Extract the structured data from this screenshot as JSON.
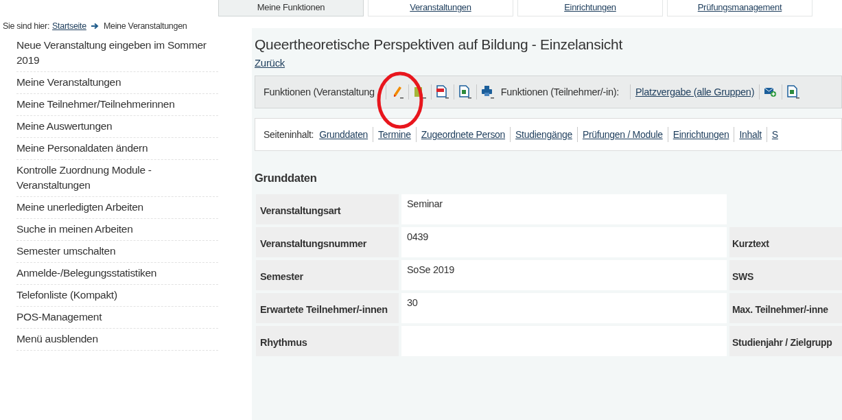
{
  "top_tabs": [
    {
      "label": "Meine Funktionen",
      "selected": true
    },
    {
      "label": "Veranstaltungen",
      "selected": false
    },
    {
      "label": "Einrichtungen",
      "selected": false
    },
    {
      "label": "Prüfungsmanagement",
      "selected": false
    }
  ],
  "breadcrumb": {
    "prefix": "Sie sind hier:",
    "link": "Startseite",
    "current": "Meine Veranstaltungen"
  },
  "sidebar": {
    "items": [
      "Neue Veranstaltung eingeben im Sommer 2019",
      "Meine Veranstaltungen",
      "Meine Teilnehmer/Teilnehmerinnen",
      "Meine Auswertungen",
      "Meine Personaldaten ändern",
      "Kontrolle Zuordnung Module - Veranstaltungen",
      "Meine unerledigten Arbeiten",
      "Suche in meinen Arbeiten",
      "Semester umschalten",
      "Anmelde-/Belegungsstatistiken",
      "Telefonliste (Kompakt)",
      "POS-Management",
      "Menü ausblenden"
    ]
  },
  "page": {
    "title": "Queertheoretische Perspektiven auf Bildung - Einzelansicht",
    "back_link": "Zurück",
    "toolbar": {
      "label_course": "Funktionen (Veranstaltung",
      "course_icons": [
        {
          "kind": "pencil"
        },
        {
          "kind": "clipboard"
        },
        {
          "kind": "pdf"
        },
        {
          "kind": "excel"
        },
        {
          "kind": "printer"
        }
      ],
      "label_participants": "Funktionen (Teilnehmer/-in):",
      "participants_link": "Platzvergabe (alle Gruppen)",
      "participant_icons": [
        {
          "kind": "mail"
        },
        {
          "kind": "excel"
        }
      ]
    },
    "annotation": {
      "kind": "circle",
      "color": "#e8161d"
    },
    "contents_bar": {
      "label": "Seiteninhalt:",
      "links": [
        "Grunddaten",
        "Termine",
        "Zugeordnete Person",
        "Studiengänge",
        "Prüfungen / Module",
        "Einrichtungen",
        "Inhalt",
        "S"
      ]
    },
    "section_title": "Grunddaten",
    "rows": [
      {
        "label": "Veranstaltungsart",
        "value": "Seminar",
        "right_label": ""
      },
      {
        "label": "Veranstaltungsnummer",
        "value": "0439",
        "right_label": "Kurztext"
      },
      {
        "label": "Semester",
        "value": "SoSe 2019",
        "right_label": "SWS"
      },
      {
        "label": "Erwartete Teilnehmer/-innen",
        "value": "30",
        "right_label": "Max. Teilnehmer/-inne"
      },
      {
        "label": "Rhythmus",
        "value": "",
        "right_label": "Studienjahr / Zielgrupp"
      }
    ]
  }
}
